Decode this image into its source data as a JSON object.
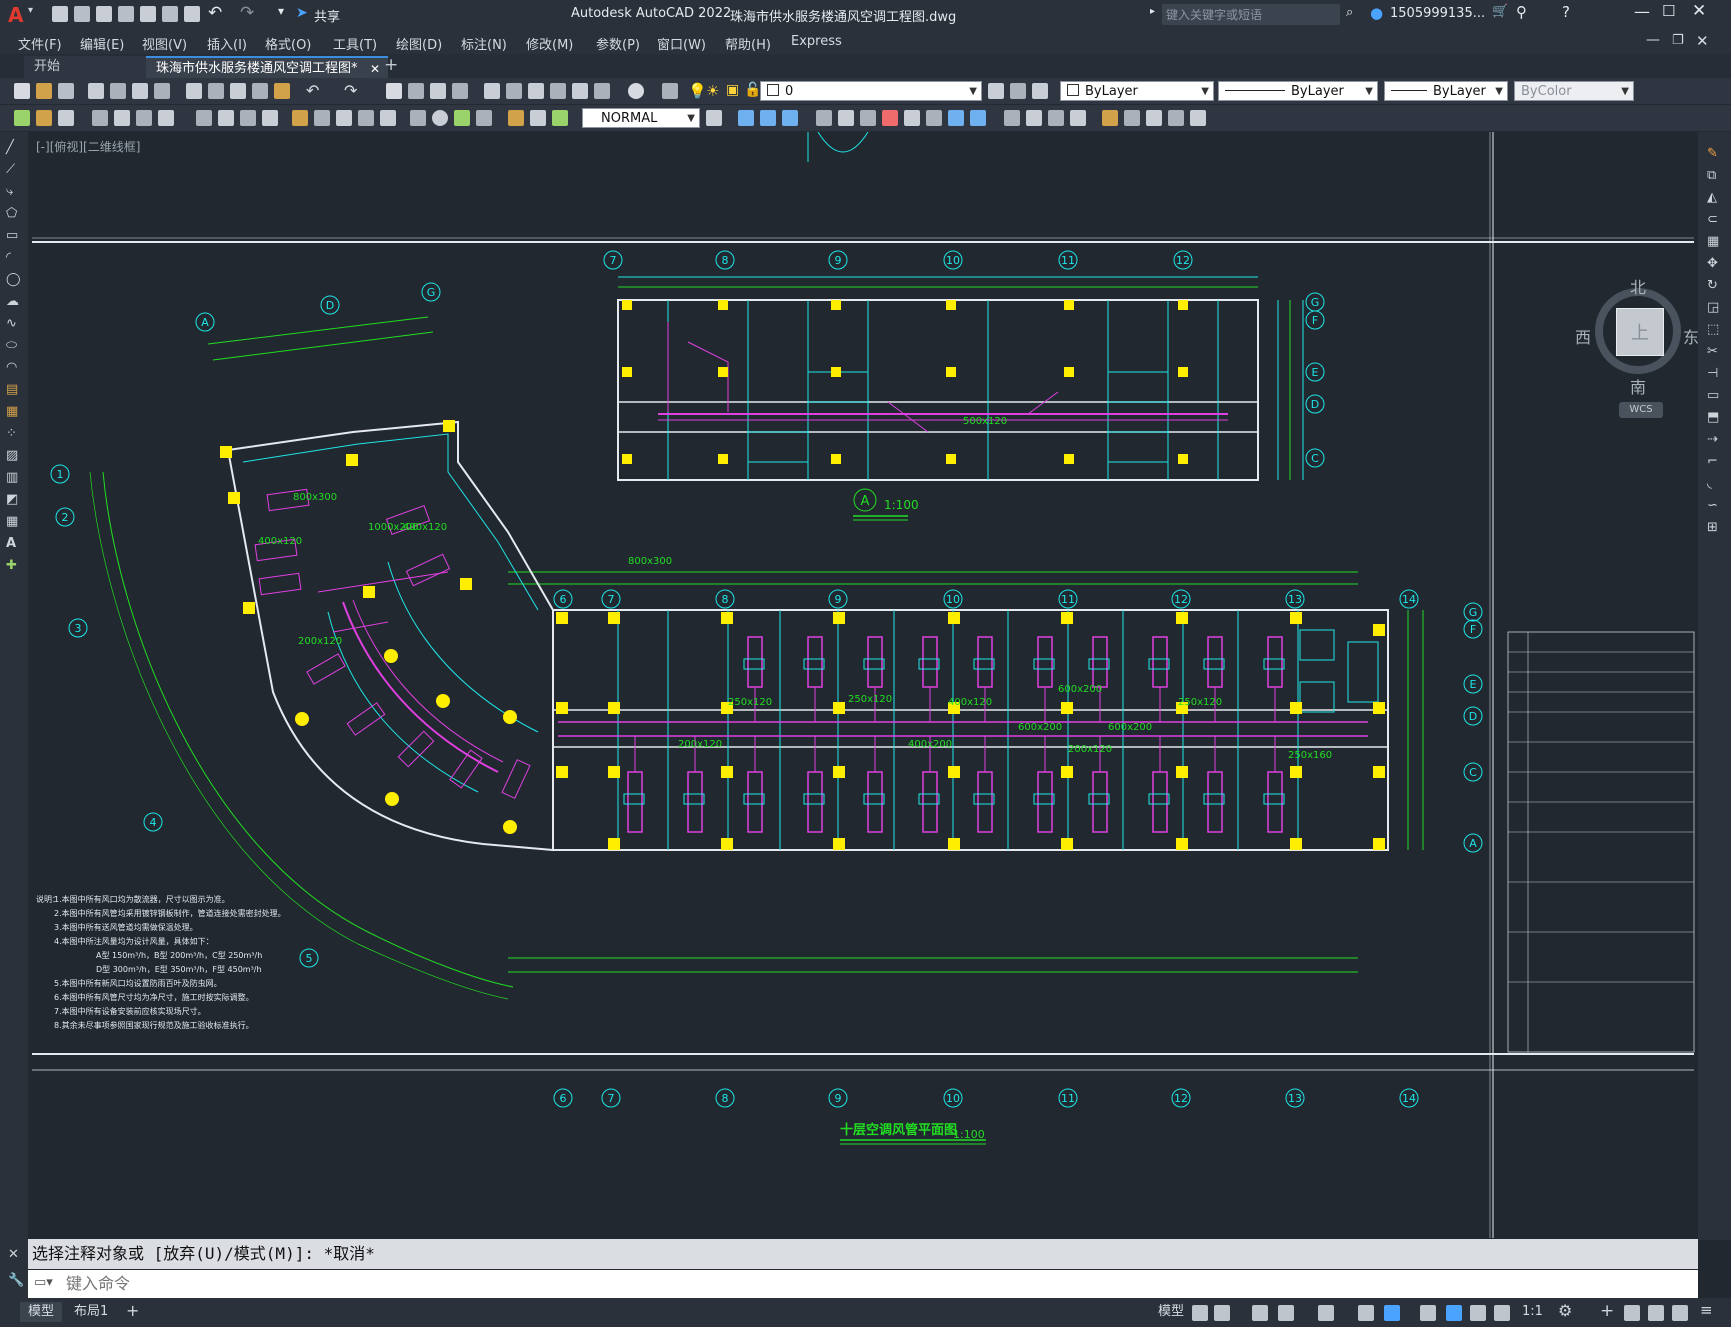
{
  "app": {
    "logo_letter": "A",
    "share_label": "共享",
    "title": "Autodesk AutoCAD 2022",
    "filename": "珠海市供水服务楼通风空调工程图.dwg",
    "search_placeholder": "键入关键字或短语",
    "user": "1505999135...",
    "window_controls": [
      "minimize-icon",
      "restore-icon",
      "close-icon"
    ]
  },
  "menu": [
    "文件(F)",
    "编辑(E)",
    "视图(V)",
    "插入(I)",
    "格式(O)",
    "工具(T)",
    "绘图(D)",
    "标注(N)",
    "修改(M)",
    "参数(P)",
    "窗口(W)",
    "帮助(H)",
    "Express"
  ],
  "tabs": [
    {
      "label": "开始"
    },
    {
      "label": "珠海市供水服务楼通风空调工程图*"
    }
  ],
  "toolbar": {
    "layer_value": "0",
    "color_value": "ByLayer",
    "linetype_value": "ByLayer",
    "lineweight_value": "ByLayer",
    "plotstyle_value": "ByColor",
    "dimstyle_value": "NORMAL"
  },
  "viewport": {
    "label": "[-][俯视][二维线框]",
    "compass": {
      "n": "北",
      "s": "南",
      "e": "东",
      "w": "西",
      "top": "上",
      "wcs": "WCS"
    }
  },
  "drawing": {
    "plan_a_scale_label": "1:100",
    "plan_a_circle": "A",
    "main_title": "十层空调风管平面图",
    "main_scale": "1:100",
    "top_grid": [
      "7",
      "8",
      "9",
      "10",
      "11",
      "12"
    ],
    "main_grid": [
      "6",
      "7",
      "8",
      "9",
      "10",
      "11",
      "12",
      "13",
      "14"
    ],
    "row_grid_top": [
      "G",
      "F",
      "E",
      "D",
      "C"
    ],
    "row_grid_main": [
      "G",
      "F",
      "E",
      "D",
      "C",
      "A"
    ],
    "left_grid_letters": [
      "A",
      "D",
      "G"
    ],
    "left_grid_numbers": [
      "1",
      "2",
      "3",
      "4",
      "5"
    ],
    "duct_labels": [
      "500x120",
      "800x300",
      "400x120",
      "250x120",
      "600x200",
      "200x120",
      "1000x200",
      "250x160",
      "400x200"
    ],
    "notes_title": "说明：",
    "notes": [
      "1.本图中所有风口均为散流器，尺寸以图示为准。",
      "2.本图中所有风管均采用镀锌钢板制作，管道连接处需密封处理。",
      "3.本图中所有送风管道均需做保温处理。",
      "4.本图中所注风量均为设计风量，具体如下：",
      "A型 150m³/h，B型 200m³/h，C型 250m³/h",
      "D型 300m³/h，E型 350m³/h，F型 450m³/h",
      "5.本图中所有新风口均设置防雨百叶及防虫网。",
      "6.本图中所有风管尺寸均为净尺寸，施工时按实际调整。",
      "7.本图中所有设备安装前应核实现场尺寸。",
      "8.其余未尽事项参照国家现行规范及施工验收标准执行。"
    ]
  },
  "command": {
    "history": "选择注释对象或 [放弃(U)/模式(M)]: *取消*",
    "placeholder": "键入命令"
  },
  "status": {
    "tabs": [
      "模型",
      "布局1"
    ],
    "scale": "1:1"
  }
}
